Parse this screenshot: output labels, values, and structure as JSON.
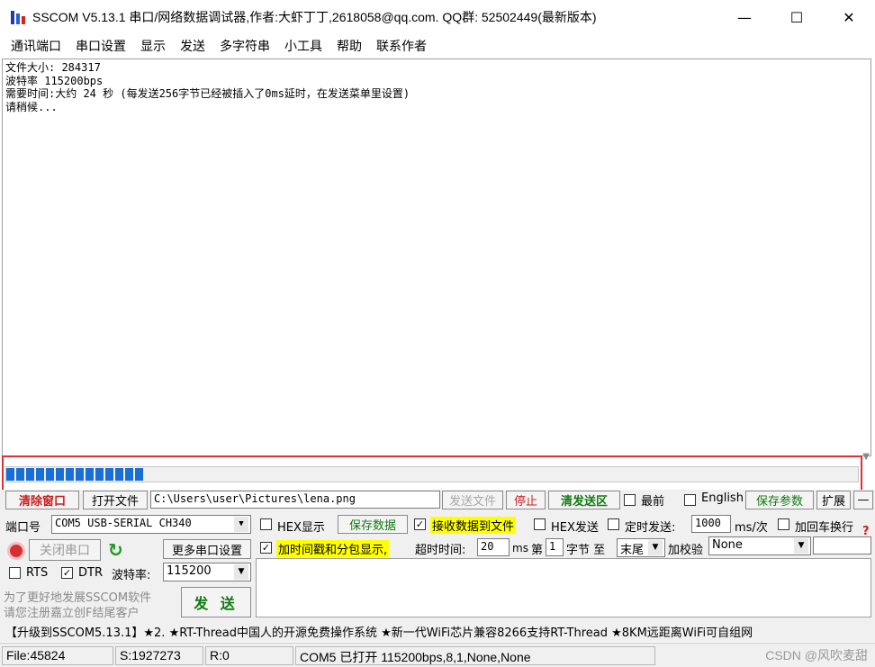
{
  "window": {
    "title": "SSCOM V5.13.1 串口/网络数据调试器,作者:大虾丁丁,2618058@qq.com. QQ群: 52502449(最新版本)",
    "minimize": "—",
    "maximize": "☐",
    "close": "✕"
  },
  "menu": [
    "通讯端口",
    "串口设置",
    "显示",
    "发送",
    "多字符串",
    "小工具",
    "帮助",
    "联系作者"
  ],
  "receive": {
    "lines": [
      "文件大小: 284317",
      "波特率 115200bps",
      "需要时间:大约 24 秒 (每发送256字节已经被插入了0ms延时，在发送菜单里设置)",
      "请稍候..."
    ]
  },
  "progress": {
    "segments_filled": 14,
    "fraction": 0.17
  },
  "toolbar1": {
    "clear_window": "清除窗口",
    "open_file": "打开文件",
    "file_path": "C:\\Users\\user\\Pictures\\lena.png",
    "send_file": "发送文件",
    "stop": "停止",
    "clear_send": "清发送区",
    "foremost": "最前",
    "english": "English",
    "save_params": "保存参数",
    "expand": "扩展",
    "collapse": "—"
  },
  "row2": {
    "port_label": "端口号",
    "port_value": "COM5 USB-SERIAL CH340",
    "hex_display": "HEX显示",
    "save_data": "保存数据",
    "recv_to_file": "接收数据到文件",
    "hex_send": "HEX发送",
    "timed_send": "定时发送:",
    "interval": "1000",
    "interval_unit": "ms/次",
    "add_crlf": "加回车换行",
    "help_mark": "?"
  },
  "row3": {
    "close_port": "关闭串口",
    "more_settings": "更多串口设置",
    "timestamp": "加时间戳和分包显示,",
    "timeout_label": "超时时间:",
    "timeout_value": "20",
    "timeout_unit": "ms",
    "byte_prefix": "第",
    "byte_index": "1",
    "byte_label": "字节 至",
    "byte_end": "末尾",
    "checksum_label": "加校验",
    "checksum_value": "None"
  },
  "row4": {
    "rts": "RTS",
    "dtr": "DTR",
    "baud_label": "波特率:",
    "baud_value": "115200"
  },
  "promo": {
    "line1": "为了更好地发展SSCOM软件",
    "line2": "请您注册嘉立创F结尾客户",
    "send": "发 送"
  },
  "adbar": "【升级到SSCOM5.13.1】★2. ★RT-Thread中国人的开源免费操作系统 ★新一代WiFi芯片兼容8266支持RT-Thread ★8KM远距离WiFi可自组网",
  "status": {
    "file": "File:45824",
    "sent": "S:1927273",
    "recv": "R:0",
    "port": "COM5 已打开  115200bps,8,1,None,None",
    "watermark": "CSDN @风吹麦甜"
  },
  "colors": {
    "progress": "#1a6fd6",
    "highlight_frame": "#e03030",
    "highlight_label": "#ffff00",
    "green_text": "#117a11"
  }
}
